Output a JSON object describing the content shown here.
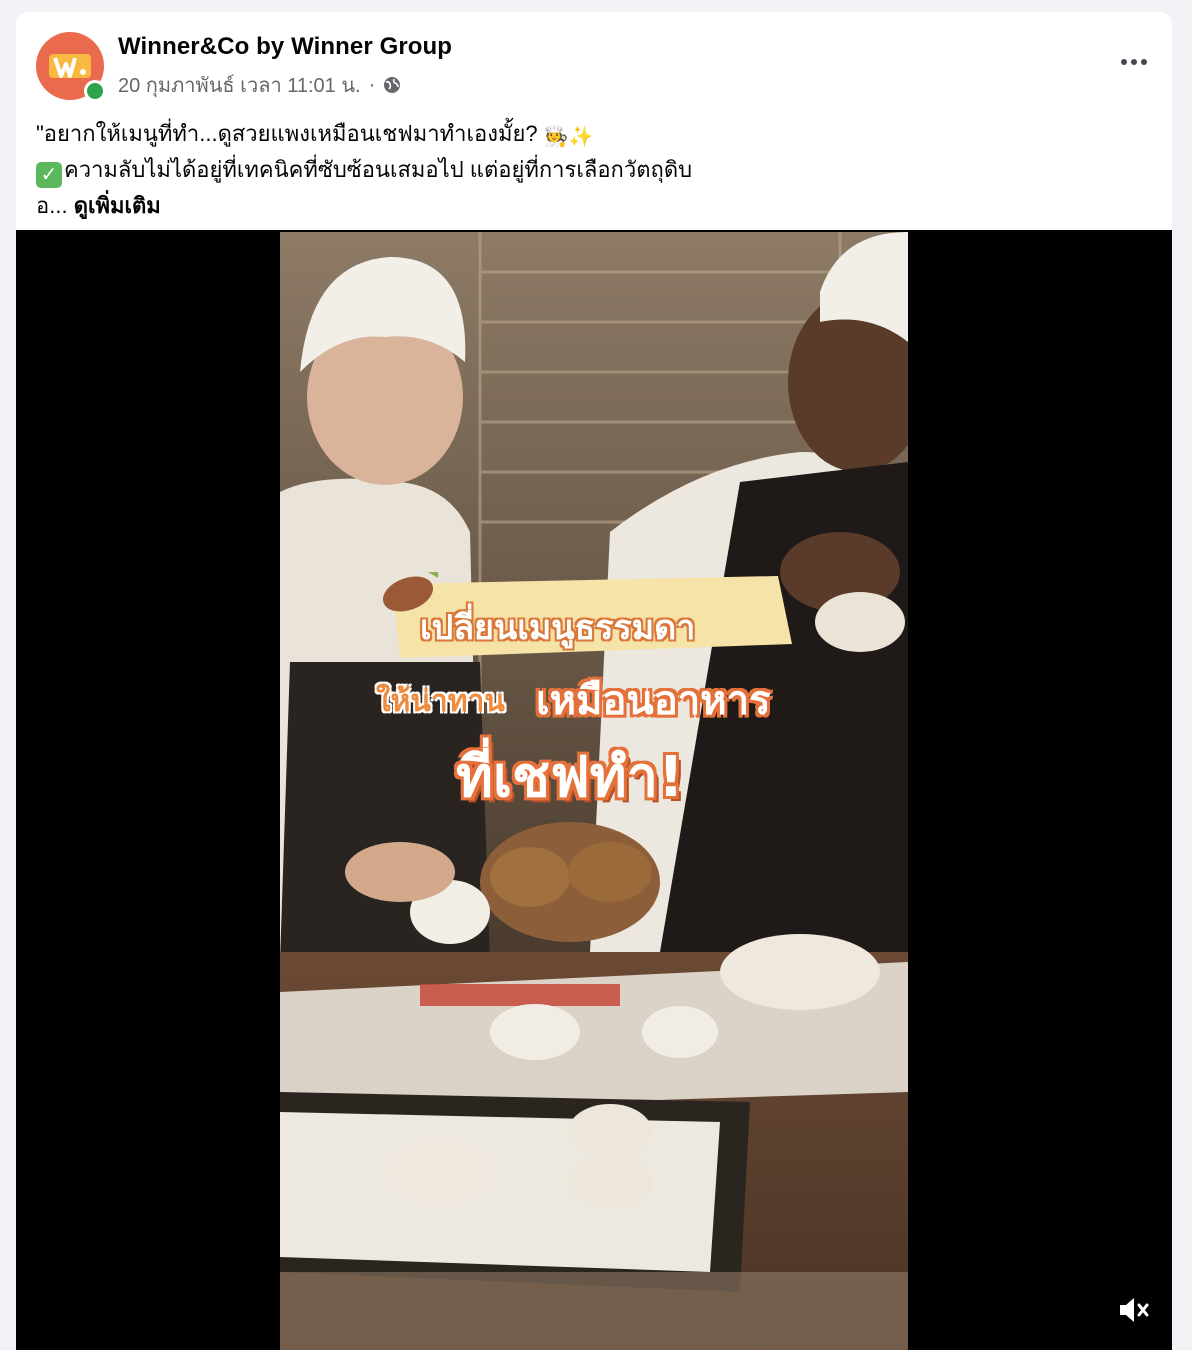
{
  "post": {
    "page_name": "Winner&Co by Winner Group",
    "timestamp": "20 กุมภาพันธ์ เวลา 11:01 น.",
    "separator": "·",
    "privacy_icon": "globe-icon",
    "more_icon": "more-options-icon",
    "avatar_icon": "winner-logo",
    "online_status_color": "#31a24c",
    "text_line1": "\"อยากให้เมนูที่ทำ...ดูสวยแพงเหมือนเชฟมาทำเองมั้ย?",
    "text_line1_emojis": "🧑‍🍳✨",
    "text_line2": "ความลับไม่ได้อยู่ที่เทคนิคที่ซับซ้อนเสมอไป แต่อยู่ที่การเลือกวัตถุดิบ",
    "text_line2_emoji": "✓",
    "text_line3": "อ...",
    "see_more": "ดูเพิ่มเติม"
  },
  "video": {
    "overlay_line1": "เปลี่ยนเมนูธรรมดา",
    "overlay_line2a": "ให้น่าทาน",
    "overlay_line2b": "เหมือนอาหาร",
    "overlay_line3": "ที่เชฟทำ!",
    "mute_icon": "muted-speaker-icon"
  }
}
